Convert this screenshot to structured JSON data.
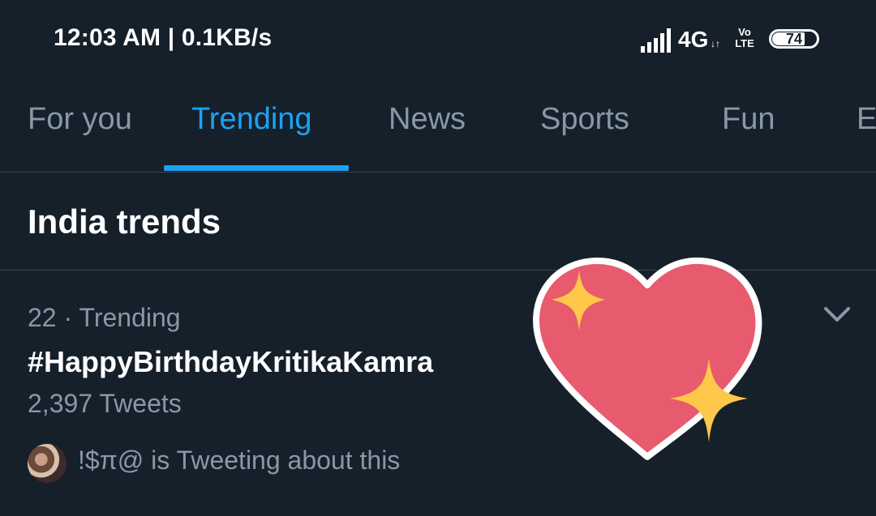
{
  "status_bar": {
    "time_speed": "12:03 AM | 0.1KB/s",
    "network": "4G",
    "network_arrows": "↓↑",
    "volte_top": "Vo",
    "volte_bottom": "LTE",
    "battery": "74",
    "battery_level_percent": 74,
    "icons": [
      "signal-icon",
      "battery-icon"
    ]
  },
  "tabs": [
    {
      "label": "For you",
      "active": false
    },
    {
      "label": "Trending",
      "active": true
    },
    {
      "label": "News",
      "active": false
    },
    {
      "label": "Sports",
      "active": false
    },
    {
      "label": "Fun",
      "active": false
    },
    {
      "label": "E",
      "active": false
    }
  ],
  "section": {
    "title": "India trends"
  },
  "trend": {
    "meta": "22 · Trending",
    "title": "#HappyBirthdayKritikaKamra",
    "count": "2,397 Tweets",
    "context": "!$π@ is Tweeting about this",
    "icons": [
      "chevron-down-icon",
      "avatar"
    ]
  },
  "sticker": {
    "name": "sparkling-heart-icon"
  },
  "colors": {
    "background": "#15202b",
    "accent": "#1da1f2",
    "secondary_text": "#8899a6",
    "divider": "#38444d",
    "heart": "#e85a6e",
    "sparkle": "#ffc84a"
  }
}
